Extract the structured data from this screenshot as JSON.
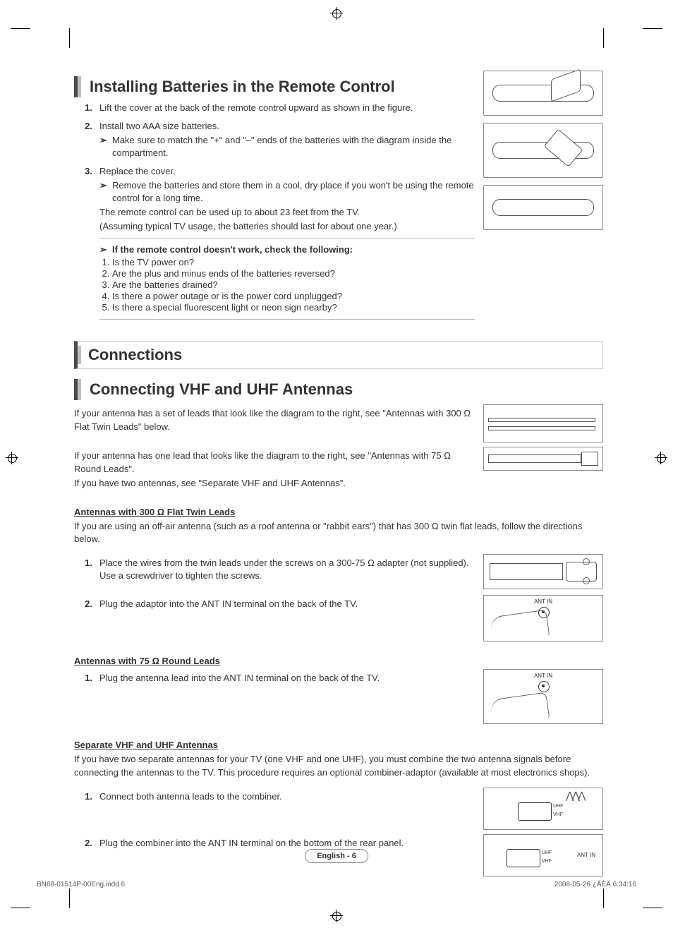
{
  "section1": {
    "title": "Installing Batteries in the Remote Control",
    "step1": "Lift the cover at the back of the remote control upward as shown in the figure.",
    "step2": "Install two AAA size batteries.",
    "step2_note": "Make sure to match the \"+\" and \"–\" ends of the batteries with the diagram inside the compartment.",
    "step3": "Replace the cover.",
    "step3_note": "Remove the batteries and store them in a cool, dry place if you won't be using the remote control for a long time.",
    "step3_sub1": "The remote control can be used up to about 23 feet from the TV.",
    "step3_sub2": "(Assuming typical TV usage, the batteries should last for about one year.)",
    "trouble_title": "If the remote control doesn't work, check the following:",
    "trouble_items": [
      "Is the TV power on?",
      "Are the plus and minus ends of the batteries reversed?",
      "Are the batteries drained?",
      "Is there a power outage or is the power cord unplugged?",
      "Is there a special fluorescent light or neon sign nearby?"
    ]
  },
  "section2": {
    "title": "Connections"
  },
  "section3": {
    "title": "Connecting VHF and UHF Antennas",
    "para1": "If your antenna has a set of leads that look like the diagram to the right, see \"Antennas with 300 Ω Flat Twin Leads\" below.",
    "para2a": "If your antenna has one lead that looks like the diagram to the right, see \"Antennas with 75 Ω Round Leads\".",
    "para2b": "If you have two antennas, see \"Separate VHF and UHF Antennas\".",
    "sub1_title": "Antennas with 300 Ω Flat Twin Leads",
    "sub1_para": "If you are using an off-air antenna (such as a roof antenna or \"rabbit ears\") that has 300 Ω twin flat leads, follow the directions below.",
    "sub1_step1a": "Place the wires from the twin leads under the screws on a 300-75 Ω adapter (not supplied).",
    "sub1_step1b": "Use a screwdriver to tighten the screws.",
    "sub1_step2": "Plug the adaptor into the ANT IN terminal on the back of the TV.",
    "sub2_title": "Antennas with 75 Ω Round Leads",
    "sub2_step1": "Plug the antenna lead into the ANT IN terminal on the back of the TV.",
    "sub3_title": "Separate VHF and UHF Antennas",
    "sub3_para": "If you have two separate antennas for your TV (one VHF and one UHF), you must combine the two antenna signals before connecting the antennas to the TV. This procedure requires an optional combiner-adaptor (available at most electronics shops).",
    "sub3_step1": "Connect both antenna leads to the combiner.",
    "sub3_step2": "Plug the combiner into the ANT IN terminal on the bottom of the rear panel."
  },
  "labels": {
    "ant_in": "ANT IN",
    "uhf": "UHF",
    "vhf": "VHF"
  },
  "page_num": "English - 6",
  "footer_left": "BN68-01514P-00Eng.indd   6",
  "footer_right": "2008-05-26   ¿ÀÈÄ 6:34:16"
}
